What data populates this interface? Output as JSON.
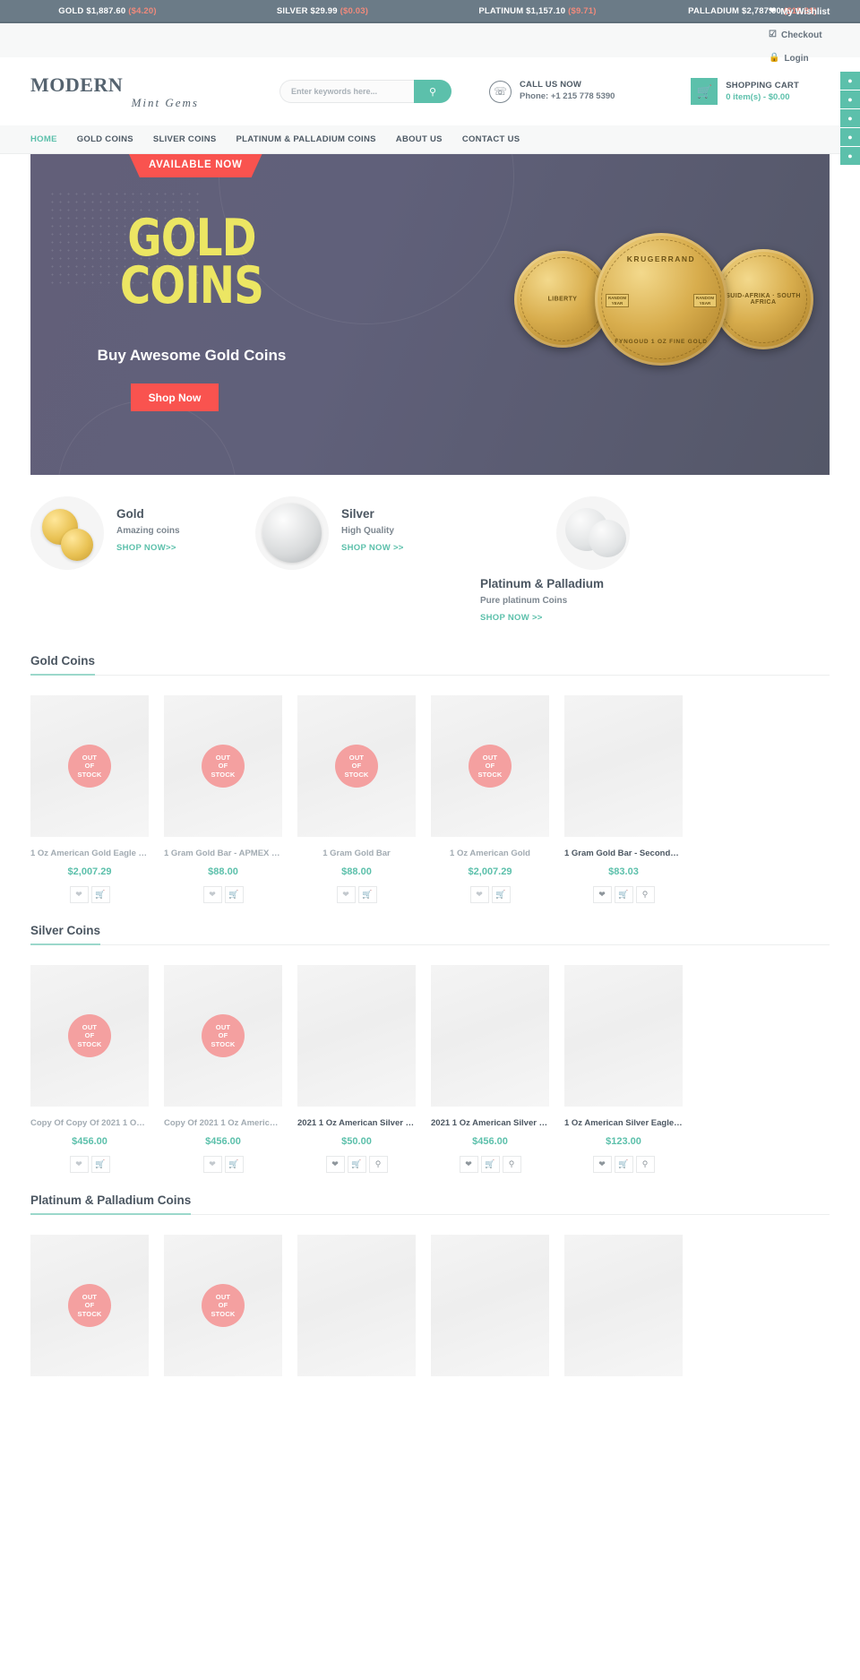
{
  "ticker": [
    {
      "metal": "GOLD",
      "price": "$1,887.60",
      "change": "($4.20)"
    },
    {
      "metal": "SILVER",
      "price": "$29.99",
      "change": "($0.03)"
    },
    {
      "metal": "PLATINUM",
      "price": "$1,157.10",
      "change": "($9.71)"
    },
    {
      "metal": "PALLADIUM",
      "price": "$2,787.00",
      "change": "($15.81)"
    }
  ],
  "utility": [
    {
      "icon": "heart-icon",
      "label": "My Wishlist"
    },
    {
      "icon": "checkout-icon",
      "label": "Checkout"
    },
    {
      "icon": "lock-icon",
      "label": "Login"
    }
  ],
  "header": {
    "logo_main": "MODERN",
    "logo_sub": "Mint Gems",
    "search_placeholder": "Enter keywords here...",
    "search_value": "",
    "search_icon": "search-icon",
    "phone_icon": "phone-icon",
    "call_title": "CALL US NOW",
    "call_phone": "Phone: +1 215 778 5390",
    "cart_icon": "basket-icon",
    "cart_title": "SHOPPING CART",
    "cart_total": "0 item(s) - $0.00"
  },
  "rail": [
    "facebook-icon",
    "twitter-icon",
    "google-icon",
    "pinterest-icon",
    "instagram-icon"
  ],
  "nav": [
    {
      "label": "HOME",
      "active": true
    },
    {
      "label": "GOLD COINS",
      "active": false
    },
    {
      "label": "SLIVER COINS",
      "active": false
    },
    {
      "label": "PLATINUM & PALLADIUM COINS",
      "active": false
    },
    {
      "label": "ABOUT US",
      "active": false
    },
    {
      "label": "CONTACT US",
      "active": false
    }
  ],
  "hero": {
    "ribbon": "AVAILABLE NOW",
    "title_line1": "GOLD",
    "title_line2": "COINS",
    "subtitle": "Buy Awesome Gold Coins",
    "button": "Shop Now",
    "coin_center_top": "KRUGERRAND",
    "coin_center_bottom": "FYNGOUD 1 OZ FINE GOLD",
    "coin_center_year": "RANDOM YEAR",
    "coin_left_label": "LIBERTY",
    "coin_right_label": "SUID-AFRIKA · SOUTH AFRICA",
    "accent_red": "#f9534f",
    "accent_yellow": "#ece663"
  },
  "categories": [
    {
      "title": "Gold",
      "desc": "Amazing coins",
      "link": "SHOP NOW>>",
      "image": "gold-coins-image"
    },
    {
      "title": "Silver",
      "desc": "High Quality",
      "link": "SHOP NOW >>",
      "image": "silver-coin-image"
    },
    {
      "title": "Platinum & Palladium",
      "desc": "Pure platinum Coins",
      "link": "SHOP NOW >>",
      "image": "platinum-coins-image"
    }
  ],
  "sections": [
    {
      "heading": "Gold Coins",
      "products": [
        {
          "title": "1 Oz American Gold Eagle B...",
          "price": "$2,007.29",
          "badge": "OUT OF STOCK",
          "hot": false,
          "actions": [
            "heart-icon",
            "basket-icon"
          ]
        },
        {
          "title": "1 Gram Gold Bar - APMEX (T...",
          "price": "$88.00",
          "badge": "OUT OF STOCK",
          "hot": false,
          "actions": [
            "heart-icon",
            "basket-icon"
          ]
        },
        {
          "title": "1 Gram Gold Bar",
          "price": "$88.00",
          "badge": "OUT OF STOCK",
          "hot": false,
          "actions": [
            "heart-icon",
            "basket-icon"
          ]
        },
        {
          "title": "1 Oz American Gold",
          "price": "$2,007.29",
          "badge": "OUT OF STOCK",
          "hot": false,
          "actions": [
            "heart-icon",
            "basket-icon"
          ]
        },
        {
          "title": "1 Gram Gold Bar - Secondar...",
          "price": "$83.03",
          "badge": "",
          "hot": true,
          "actions": [
            "heart-icon",
            "basket-icon",
            "search-icon"
          ]
        }
      ]
    },
    {
      "heading": "Silver Coins",
      "products": [
        {
          "title": "Copy Of Copy Of 2021 1 Oz A...",
          "price": "$456.00",
          "badge": "OUT OF STOCK",
          "hot": false,
          "actions": [
            "heart-icon",
            "basket-icon"
          ]
        },
        {
          "title": "Copy Of 2021 1 Oz American...",
          "price": "$456.00",
          "badge": "OUT OF STOCK",
          "hot": false,
          "actions": [
            "heart-icon",
            "basket-icon"
          ]
        },
        {
          "title": "2021 1 Oz American Silver E...",
          "price": "$50.00",
          "badge": "",
          "hot": true,
          "actions": [
            "heart-icon",
            "basket-icon",
            "search-icon"
          ]
        },
        {
          "title": "2021 1 Oz American Silver E...",
          "price": "$456.00",
          "badge": "",
          "hot": true,
          "actions": [
            "heart-icon",
            "basket-icon",
            "search-icon"
          ]
        },
        {
          "title": "1 Oz American Silver Eagle ...",
          "price": "$123.00",
          "badge": "",
          "hot": true,
          "actions": [
            "heart-icon",
            "basket-icon",
            "search-icon"
          ]
        }
      ]
    },
    {
      "heading": "Platinum & Palladium Coins",
      "products": [
        {
          "title": "",
          "price": "",
          "badge": "OUT OF STOCK",
          "hot": false,
          "actions": []
        },
        {
          "title": "",
          "price": "",
          "badge": "OUT OF STOCK",
          "hot": false,
          "actions": []
        },
        {
          "title": "",
          "price": "",
          "badge": "",
          "hot": false,
          "actions": []
        },
        {
          "title": "",
          "price": "",
          "badge": "",
          "hot": false,
          "actions": []
        },
        {
          "title": "",
          "price": "",
          "badge": "",
          "hot": false,
          "actions": []
        }
      ]
    }
  ]
}
